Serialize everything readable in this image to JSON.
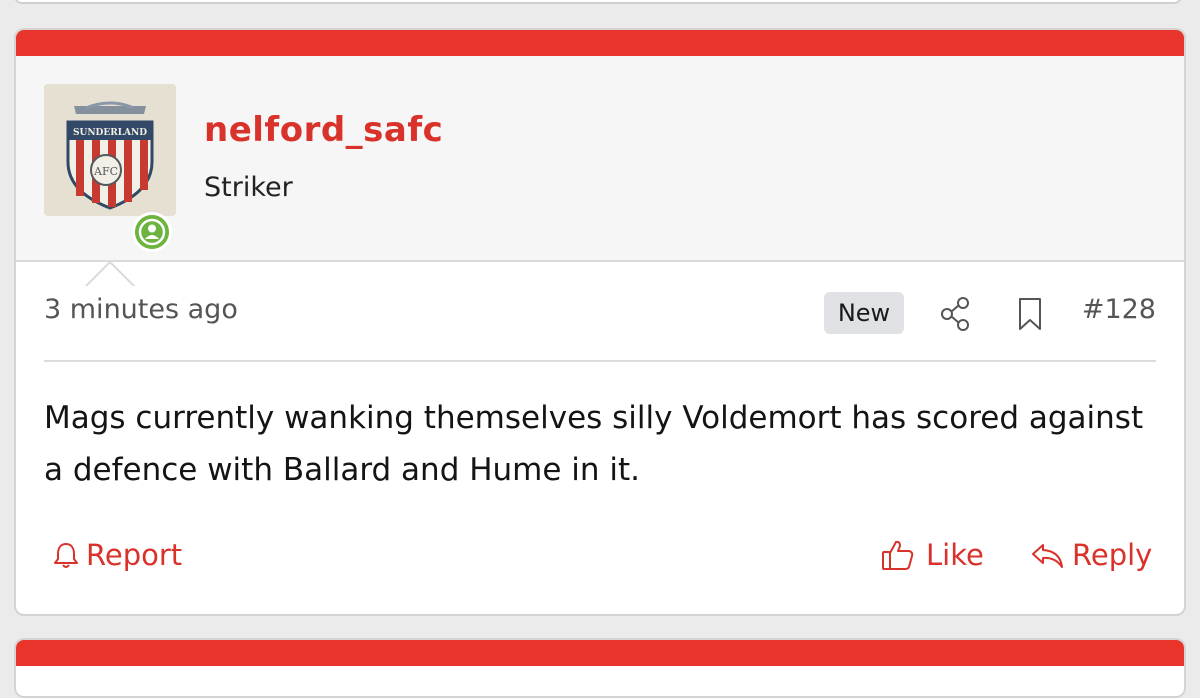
{
  "post": {
    "username": "nelford_safc",
    "user_title": "Striker",
    "avatar_text": "SUNDERLAND",
    "avatar_icon": "sunderland-crest",
    "online_icon": "user-online-icon",
    "timestamp": "3 minutes ago",
    "new_badge": "New",
    "post_number": "#128",
    "message": "Mags currently wanking themselves silly Voldemort has scored against a defence with Ballard and Hume in it.",
    "actions": {
      "report": "Report",
      "like": "Like",
      "reply": "Reply"
    }
  },
  "colors": {
    "accent": "#e8342a",
    "link": "#d9322a",
    "online": "#6cb33f"
  }
}
